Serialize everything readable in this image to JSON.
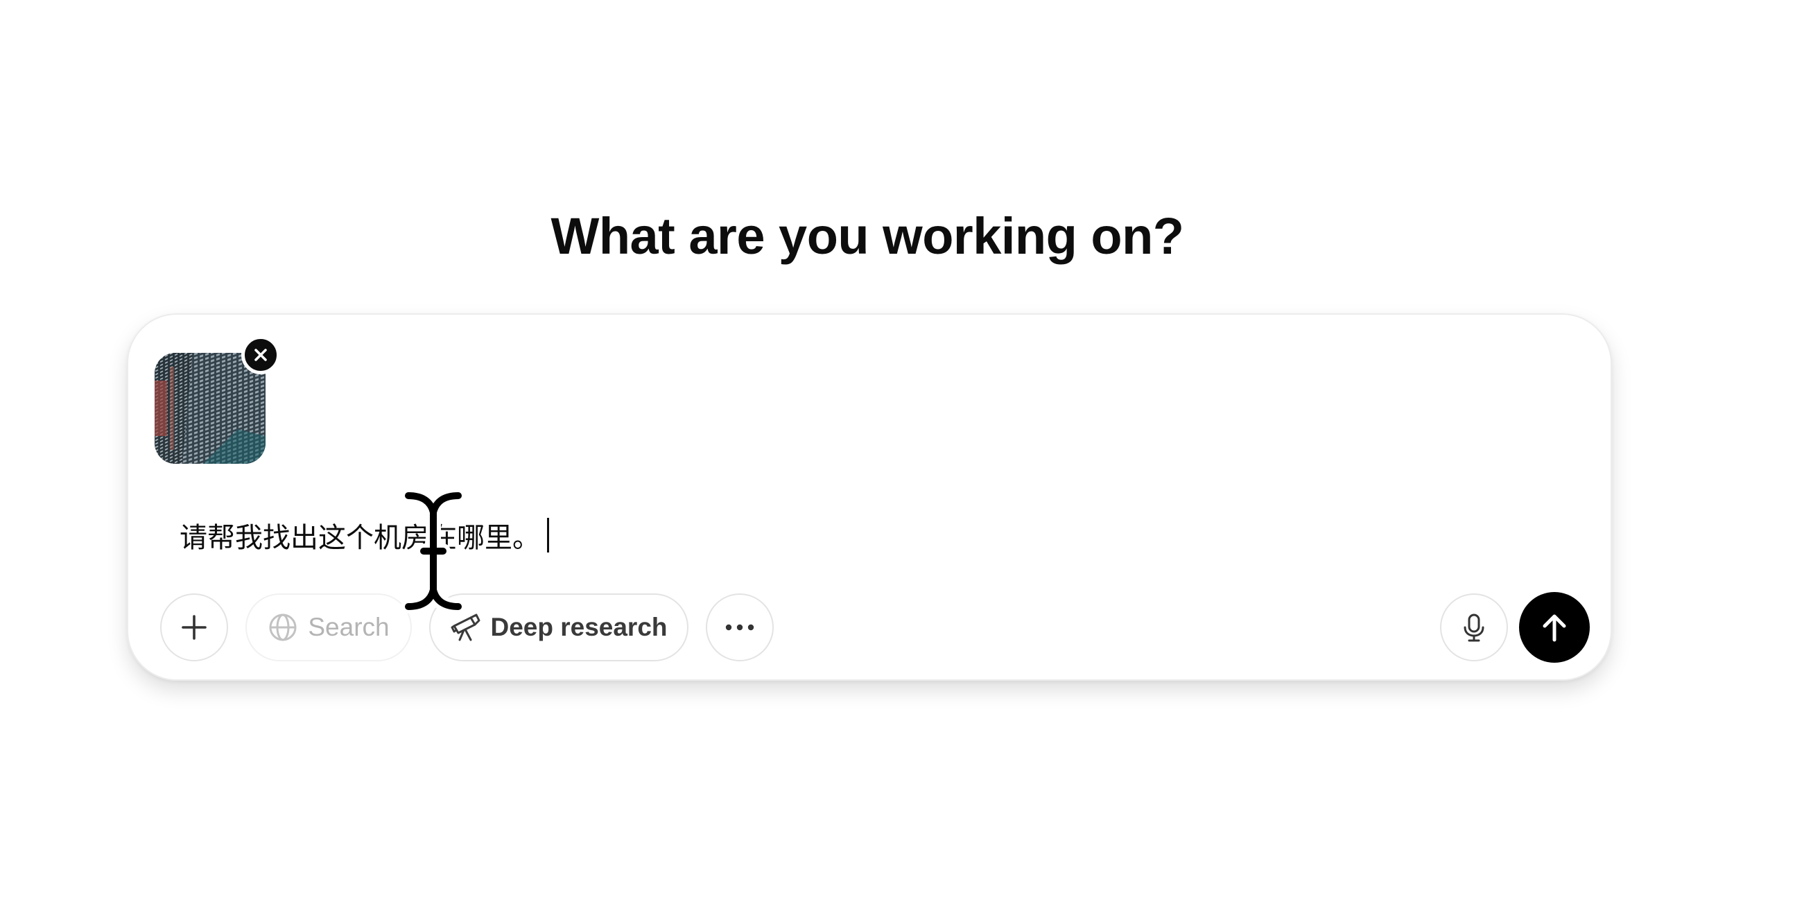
{
  "heading": "What are you working on?",
  "composer": {
    "attachment": {
      "image": "building-facade-thumbnail",
      "remove_icon": "close-icon"
    },
    "input_value": "请帮我找出这个机房在哪里。",
    "toolbar": {
      "add_icon": "plus-icon",
      "search_label": "Search",
      "search_icon": "globe-icon",
      "deep_research_label": "Deep research",
      "deep_research_icon": "telescope-icon",
      "more_icon": "ellipsis-icon",
      "mic_icon": "microphone-icon",
      "send_icon": "arrow-up-icon"
    }
  },
  "colors": {
    "text": "#0d0d0d",
    "send_button": "#000000",
    "border": "#e3e3e3",
    "disabled_text": "#b4b4b4"
  }
}
